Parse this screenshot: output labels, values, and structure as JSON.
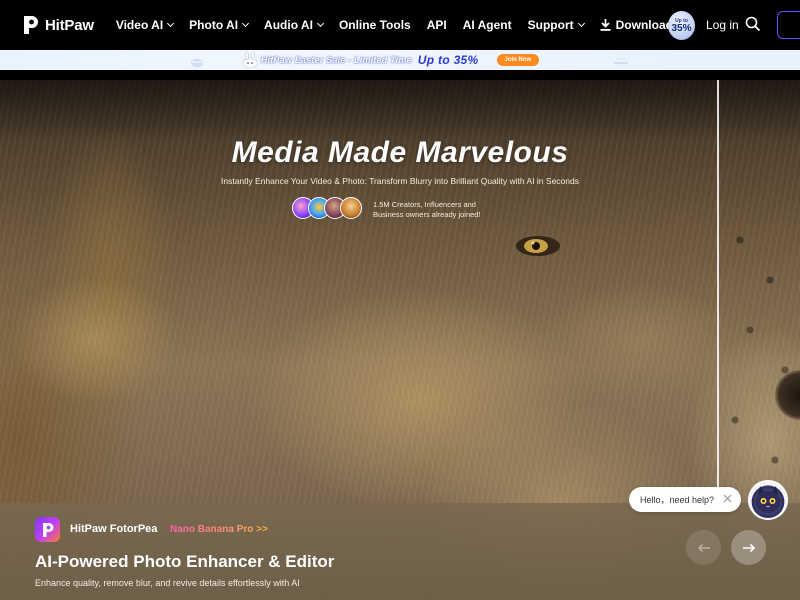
{
  "brand": {
    "name": "HitPaw"
  },
  "nav": {
    "items": [
      {
        "label": "Video AI",
        "dropdown": true
      },
      {
        "label": "Photo AI",
        "dropdown": true
      },
      {
        "label": "Audio AI",
        "dropdown": true
      },
      {
        "label": "Online Tools",
        "dropdown": false
      },
      {
        "label": "API",
        "dropdown": false
      },
      {
        "label": "AI Agent",
        "dropdown": false
      },
      {
        "label": "Support",
        "dropdown": true
      }
    ],
    "download_label": "Download",
    "login_label": "Log in",
    "badge": {
      "top": "Up to",
      "num": "35%"
    }
  },
  "promo": {
    "text": "HitPaw Easter Sale - Limited Time",
    "highlight": "Up to 35%",
    "button": "Join Now"
  },
  "hero": {
    "title": "Media Made Marvelous",
    "subtitle": "Instantly Enhance Your Video & Photo: Transform Blurry into Brilliant Quality with AI in Seconds",
    "social_proof_line1": "1.5M Creators, Influencers and",
    "social_proof_line2": "Business owners already joined!"
  },
  "product": {
    "name": "HitPaw FotorPea",
    "tag": "Nano Banana Pro >>",
    "title": "AI-Powered Photo Enhancer & Editor",
    "subtitle": "Enhance quality, remove blur, and revive details effortlessly with AI"
  },
  "chat": {
    "text": "Hello，need help?"
  },
  "colors": {
    "nav_bg": "#000000",
    "accent": "#6a4cff",
    "promo_button": "#ff8a1f",
    "promo_highlight": "#2a3ccf",
    "tag_gradient_start": "#ff5fa8",
    "tag_gradient_end": "#ffb14a"
  },
  "icons": {
    "logo": "hitpaw-logo-icon",
    "dropdown": "chevron-down-icon",
    "download": "download-icon",
    "search": "search-icon",
    "prev": "arrow-left-icon",
    "next": "arrow-right-icon",
    "close": "close-icon"
  }
}
